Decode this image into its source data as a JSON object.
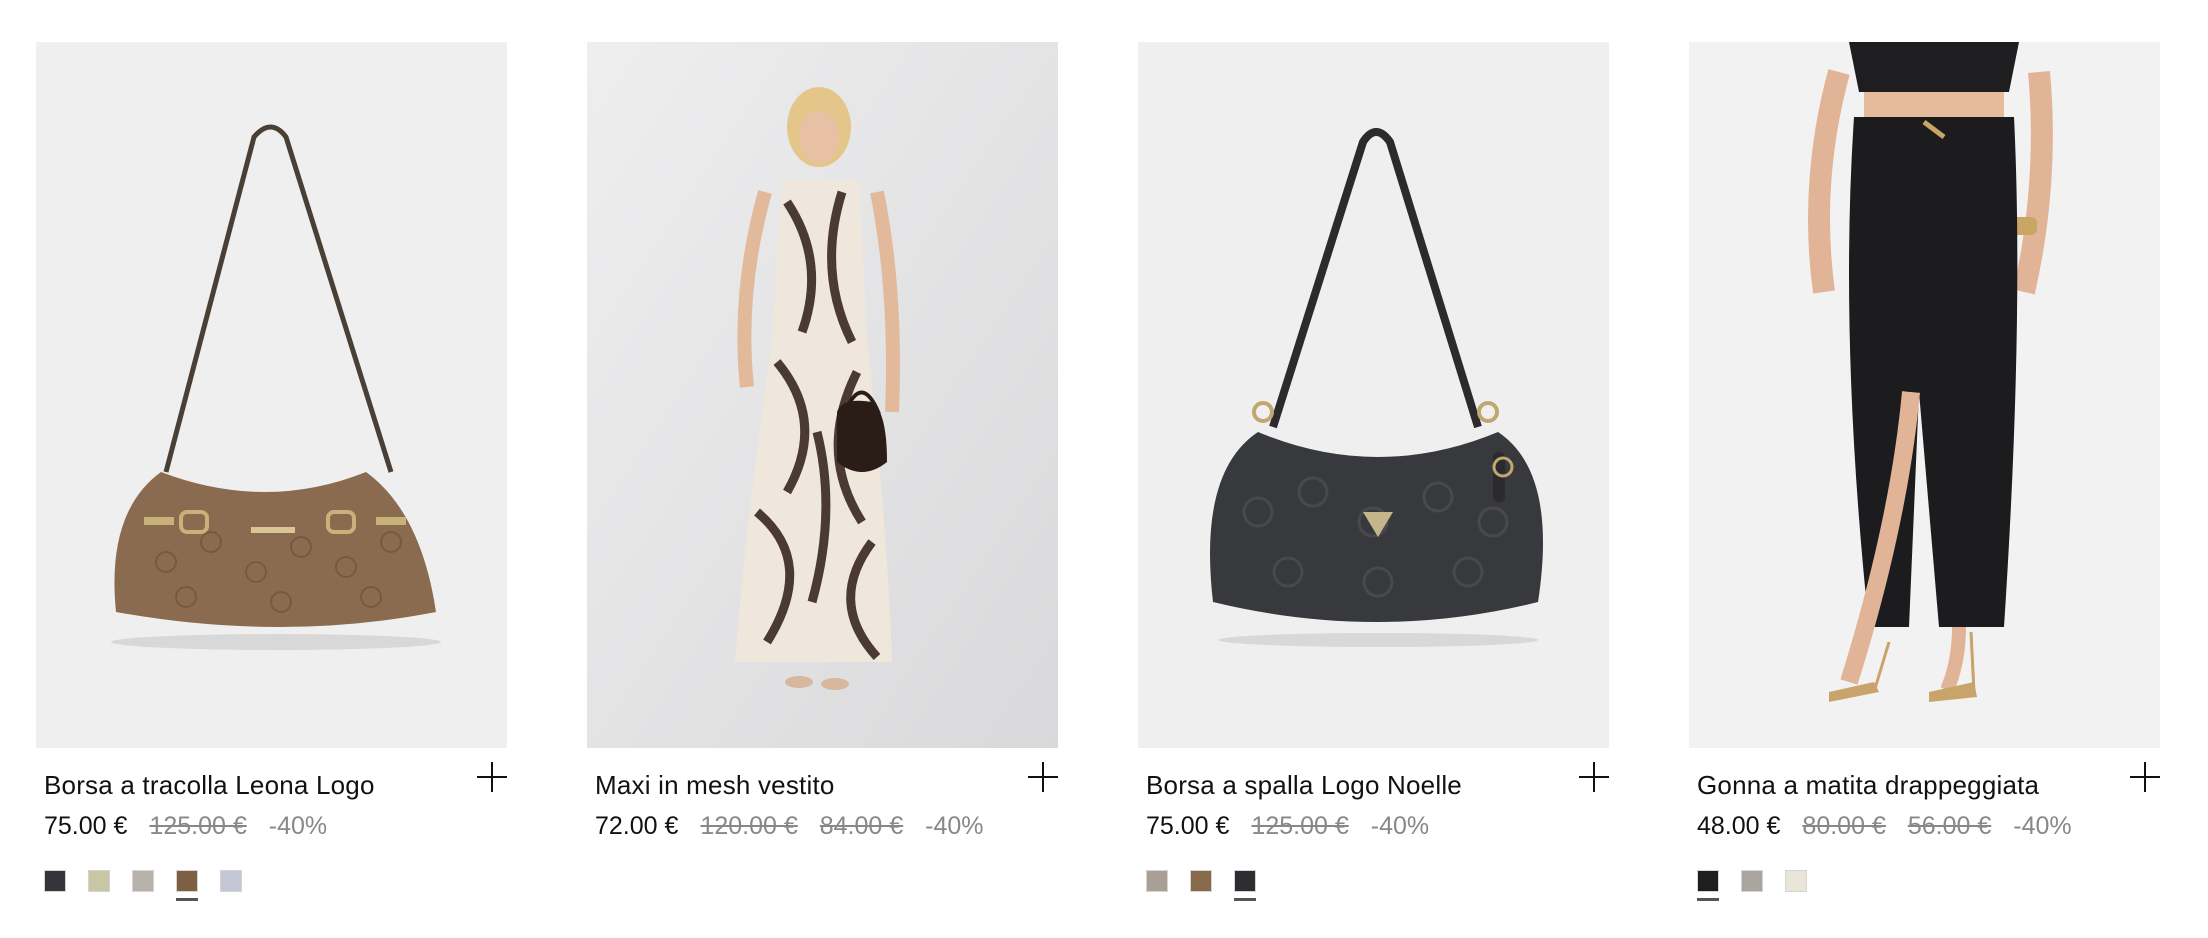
{
  "products": [
    {
      "title": "Borsa a tracolla Leona Logo",
      "price": "75.00 €",
      "old_prices": [
        "125.00 €"
      ],
      "discount": "-40%",
      "swatches": [
        {
          "color": "#34353a",
          "selected": false
        },
        {
          "color": "#c9c6a4",
          "selected": false
        },
        {
          "color": "#b7b3ab",
          "selected": false
        },
        {
          "color": "#7d5f43",
          "selected": true
        },
        {
          "color": "#c5c7d6",
          "selected": false
        }
      ]
    },
    {
      "title": "Maxi in mesh vestito",
      "price": "72.00 €",
      "old_prices": [
        "120.00 €",
        "84.00 €"
      ],
      "discount": "-40%",
      "swatches": []
    },
    {
      "title": "Borsa a spalla Logo Noelle",
      "price": "75.00 €",
      "old_prices": [
        "125.00 €"
      ],
      "discount": "-40%",
      "swatches": [
        {
          "color": "#a99f94",
          "selected": false
        },
        {
          "color": "#8a6a4c",
          "selected": false
        },
        {
          "color": "#2c2d31",
          "selected": true
        }
      ]
    },
    {
      "title": "Gonna a matita drappeggiata",
      "price": "48.00 €",
      "old_prices": [
        "80.00 €",
        "56.00 €"
      ],
      "discount": "-40%",
      "swatches": [
        {
          "color": "#1e1e21",
          "selected": true
        },
        {
          "color": "#a8a69e",
          "selected": false
        },
        {
          "color": "#e9e5d9",
          "selected": false
        }
      ]
    }
  ]
}
